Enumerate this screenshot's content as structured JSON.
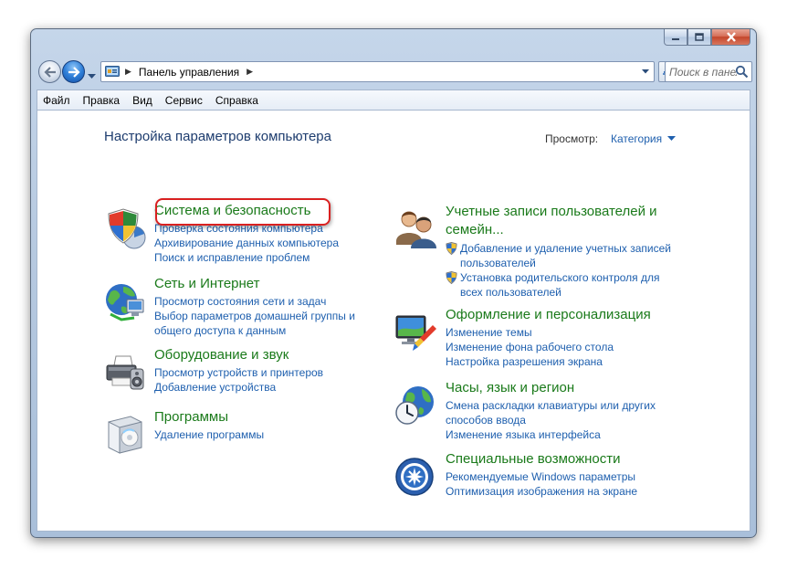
{
  "titlebar": {
    "buttons": [
      {
        "name": "minimize",
        "icon": "minimize-icon"
      },
      {
        "name": "maximize",
        "icon": "maximize-icon"
      },
      {
        "name": "close",
        "icon": "close-icon"
      }
    ]
  },
  "nav": {
    "address_text": "Панель управления",
    "search_placeholder": "Поиск в панели управления"
  },
  "menubar": {
    "items": [
      "Файл",
      "Правка",
      "Вид",
      "Сервис",
      "Справка"
    ]
  },
  "header": {
    "title": "Настройка параметров компьютера",
    "view_by_label": "Просмотр:",
    "view_by_value": "Категория"
  },
  "categories_left": [
    {
      "title": "Система и безопасность",
      "icon": "security-shield-icon",
      "links": [
        "Проверка состояния компьютера",
        "Архивирование данных компьютера",
        "Поиск и исправление проблем"
      ]
    },
    {
      "title": "Сеть и Интернет",
      "icon": "network-globe-icon",
      "links": [
        "Просмотр состояния сети и задач",
        "Выбор параметров домашней группы и",
        "общего доступа к данным"
      ]
    },
    {
      "title": "Оборудование и звук",
      "icon": "printer-icon",
      "links": [
        "Просмотр устройств и принтеров",
        "Добавление устройства"
      ]
    },
    {
      "title": "Программы",
      "icon": "programs-icon",
      "links": [
        "Удаление программы"
      ]
    }
  ],
  "categories_right": [
    {
      "title_line1": "Учетные записи пользователей и",
      "title_line2": "семейн...",
      "icon": "users-icon",
      "links": [
        {
          "line1": "Добавление и удаление учетных записей",
          "line2": "пользователей"
        },
        {
          "line1": "Установка родительского контроля для",
          "line2": "всех пользователей"
        }
      ]
    },
    {
      "title": "Оформление и персонализация",
      "icon": "personalization-icon",
      "links": [
        "Изменение темы",
        "Изменение фона рабочего стола",
        "Настройка разрешения экрана"
      ]
    },
    {
      "title": "Часы, язык и регион",
      "icon": "clock-globe-icon",
      "links": [
        "Смена раскладки клавиатуры или других",
        "способов ввода",
        "Изменение языка интерфейса"
      ]
    },
    {
      "title": "Специальные возможности",
      "icon": "accessibility-icon",
      "links": [
        "Рекомендуемые Windows параметры",
        "Оптимизация изображения на экране"
      ]
    }
  ],
  "colors": {
    "category_title": "#1a7a1a",
    "link": "#1e5fae",
    "page_title": "#1d3c6e",
    "highlight": "#d92020"
  }
}
